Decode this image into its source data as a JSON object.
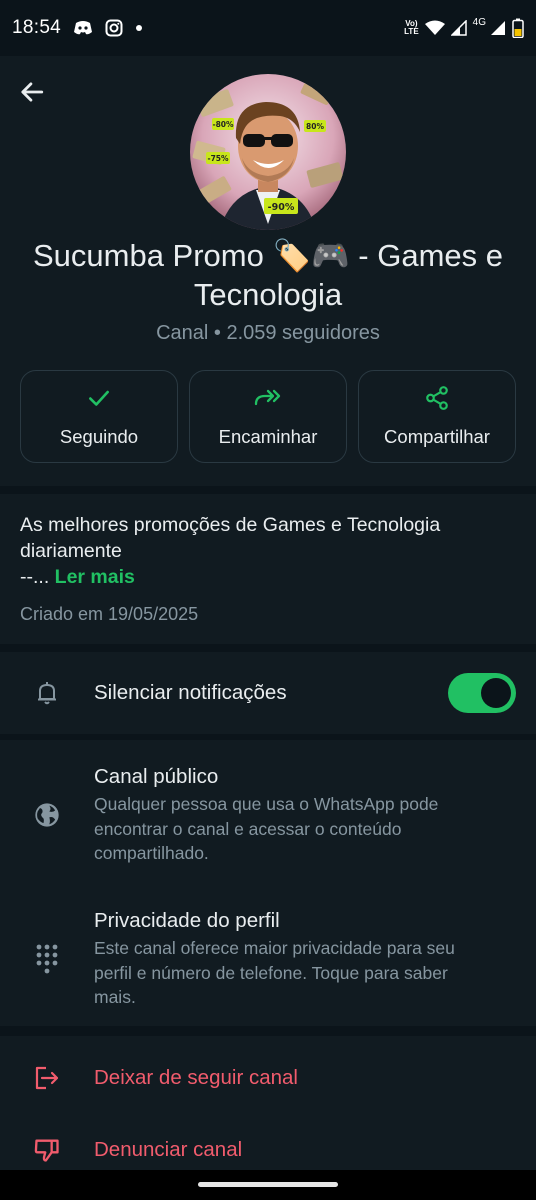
{
  "status_bar": {
    "time": "18:54",
    "left_icons": [
      "discord-icon",
      "instagram-icon",
      "notification-dot-icon"
    ],
    "lte_line1": "Vo)",
    "lte_line2": "LTE",
    "network": "4G",
    "right_icons": [
      "wifi-icon",
      "signal-icon",
      "battery-icon"
    ]
  },
  "header": {
    "back_icon": "arrow-left-icon",
    "channel_name": "Sucumba Promo 🏷️🎮 - Games e Tecnologia",
    "channel_meta": "Canal • 2.059 seguidores",
    "avatar_badges": [
      "-80%",
      "80%",
      "-75%",
      "-90%"
    ]
  },
  "actions": [
    {
      "label": "Seguindo",
      "icon": "check-icon"
    },
    {
      "label": "Encaminhar",
      "icon": "forward-icon"
    },
    {
      "label": "Compartilhar",
      "icon": "share-icon"
    }
  ],
  "description": {
    "text": "As melhores promoções de Games e Tecnologia diariamente",
    "ellipsis": "--...",
    "read_more": "Ler mais",
    "created": "Criado em 19/05/2025"
  },
  "mute": {
    "label": "Silenciar notificações",
    "icon": "bell-icon",
    "enabled": true
  },
  "privacy": {
    "public": {
      "title": "Canal público",
      "subtitle": "Qualquer pessoa que usa o WhatsApp pode encontrar o canal e acessar o conteúdo compartilhado.",
      "icon": "globe-icon"
    },
    "profile": {
      "title": "Privacidade do perfil",
      "subtitle": "Este canal oferece maior privacidade para seu perfil e número de telefone. Toque para saber mais.",
      "icon": "dialpad-icon"
    }
  },
  "danger": {
    "unfollow": {
      "label": "Deixar de seguir canal",
      "icon": "exit-icon"
    },
    "report": {
      "label": "Denunciar canal",
      "icon": "thumbs-down-icon"
    }
  },
  "colors": {
    "background": "#0b141a",
    "surface": "#111b21",
    "accent": "#21c063",
    "danger": "#f15c6d",
    "muted": "#8696a0"
  }
}
